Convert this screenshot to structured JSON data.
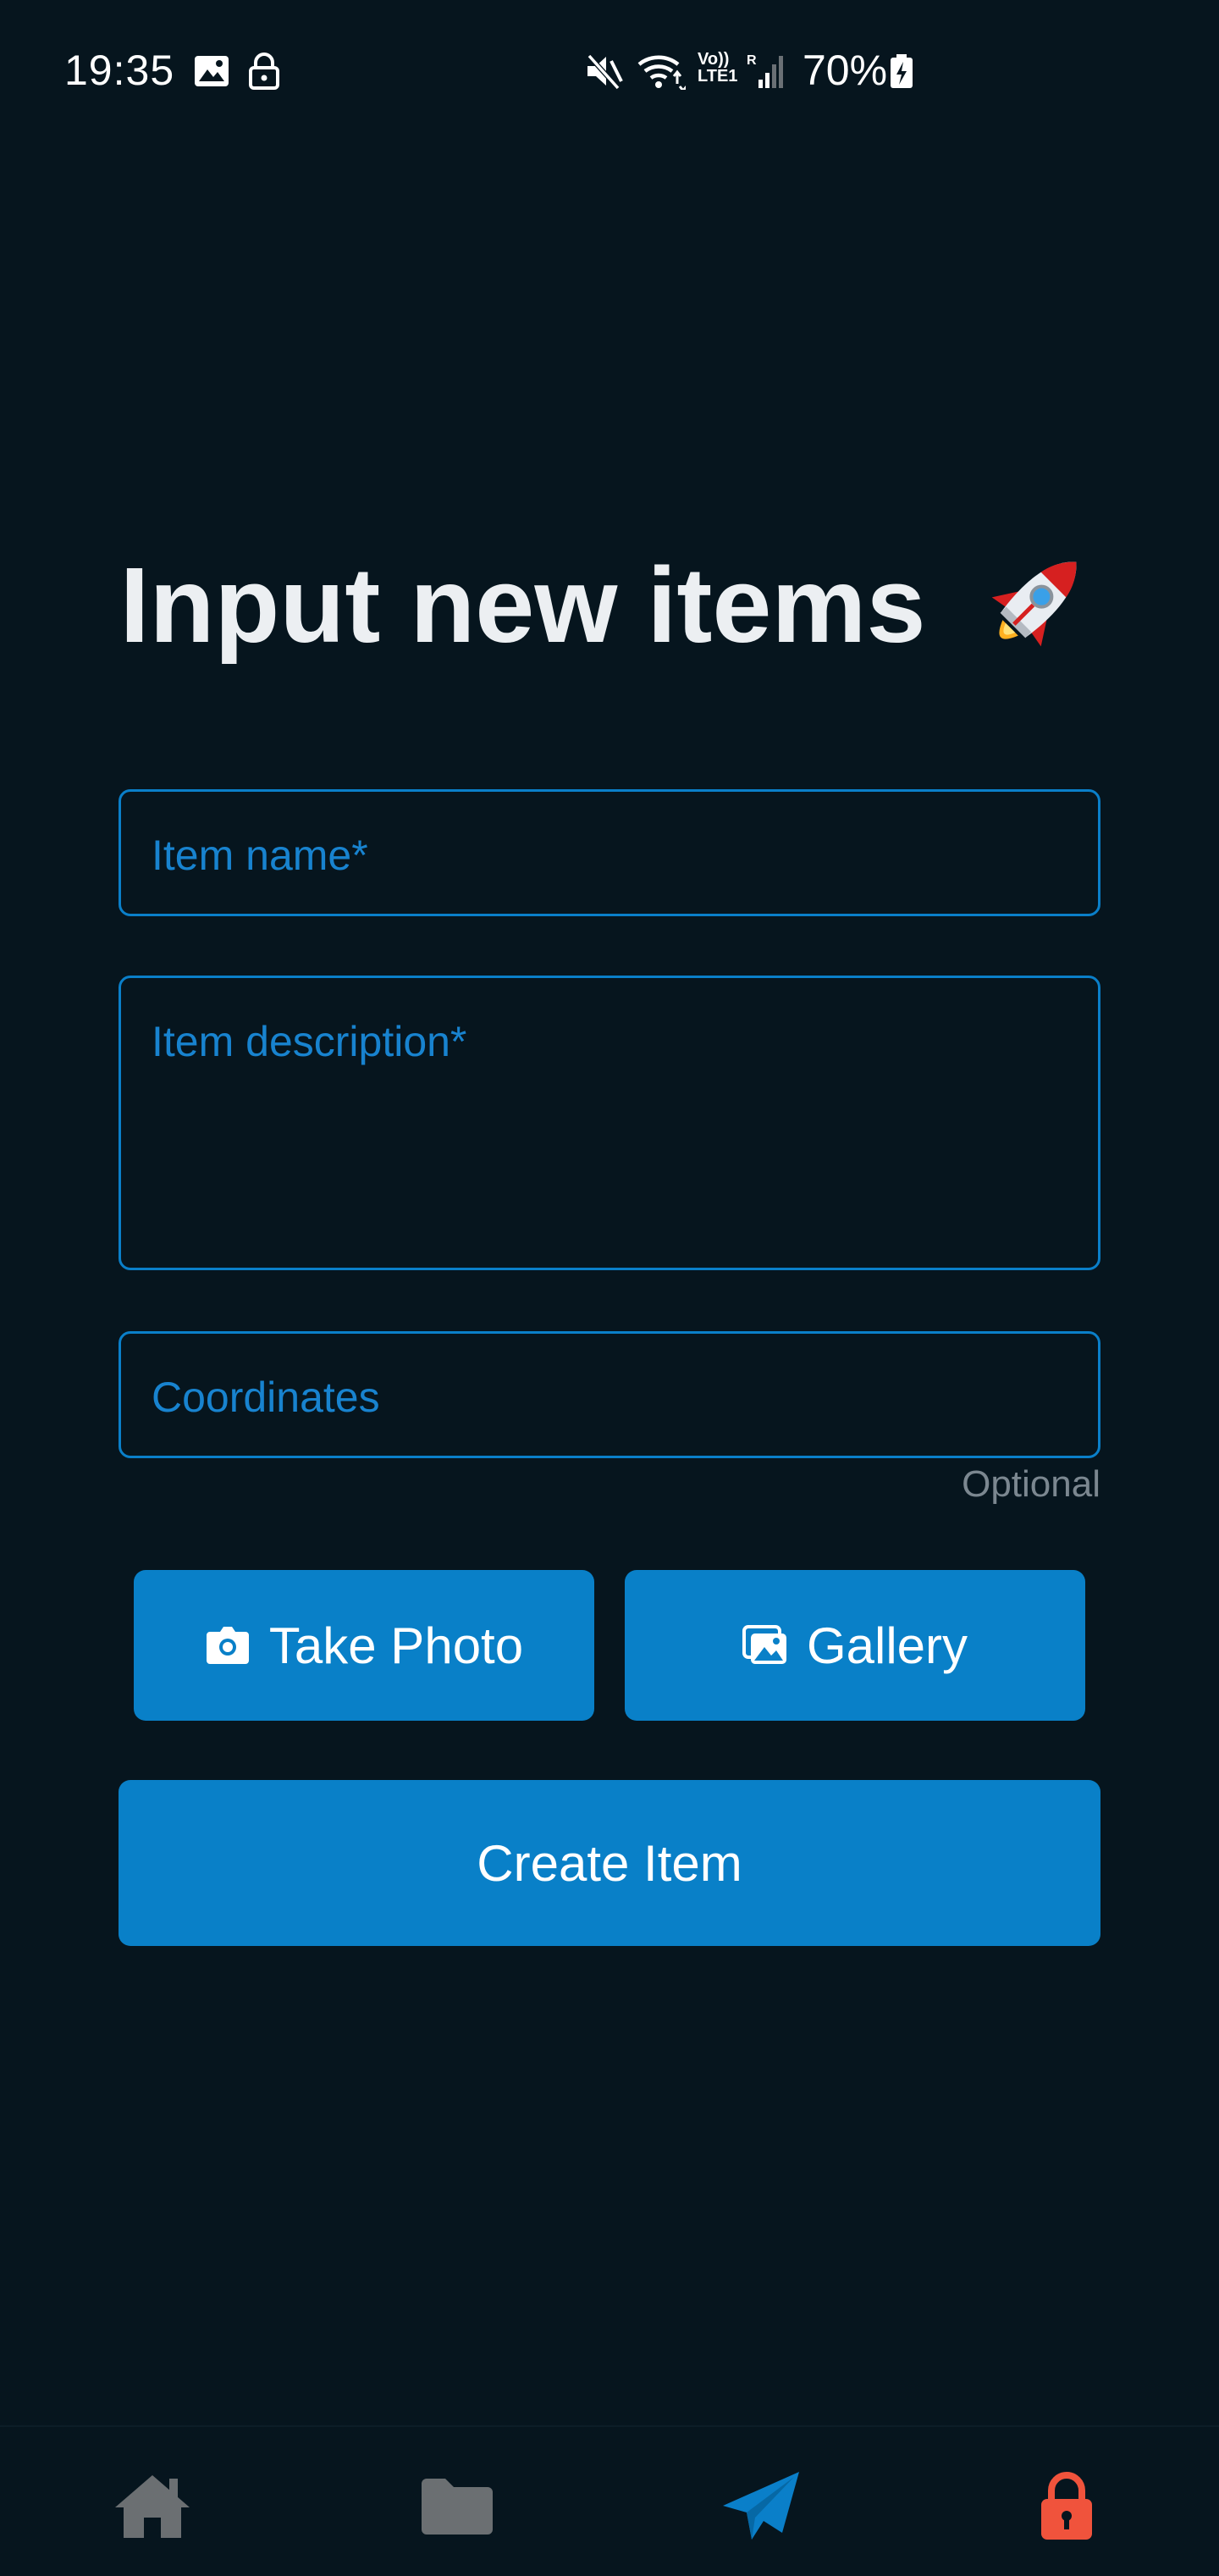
{
  "status_bar": {
    "time": "19:35",
    "network_label_top": "Vo))",
    "network_label_bottom": "LTE1",
    "roaming": "R",
    "battery": "70%",
    "icons": [
      "image-icon",
      "lock-icon",
      "mute-icon",
      "wifi-icon",
      "signal-icon",
      "battery-charging-icon"
    ]
  },
  "page": {
    "title": "Input new items",
    "title_emoji_icon": "rocket-icon"
  },
  "form": {
    "item_name_placeholder": "Item name*",
    "item_description_placeholder": "Item description*",
    "coordinates_placeholder": "Coordinates",
    "coordinates_hint": "Optional"
  },
  "buttons": {
    "take_photo_label": "Take Photo",
    "take_photo_icon": "camera-icon",
    "gallery_label": "Gallery",
    "gallery_icon": "gallery-icon",
    "create_label": "Create Item"
  },
  "bottom_nav": {
    "items": [
      {
        "icon": "home-icon",
        "active": false
      },
      {
        "icon": "folder-icon",
        "active": false
      },
      {
        "icon": "send-icon",
        "active": true
      },
      {
        "icon": "lock-icon",
        "active": false
      }
    ]
  },
  "colors": {
    "background": "#06151e",
    "accent": "#0980c8",
    "field_border": "#0a7fc9",
    "placeholder": "#1883cf",
    "nav_inactive": "#6b6f72",
    "nav_lock": "#f0533c",
    "title": "#eceff2"
  }
}
